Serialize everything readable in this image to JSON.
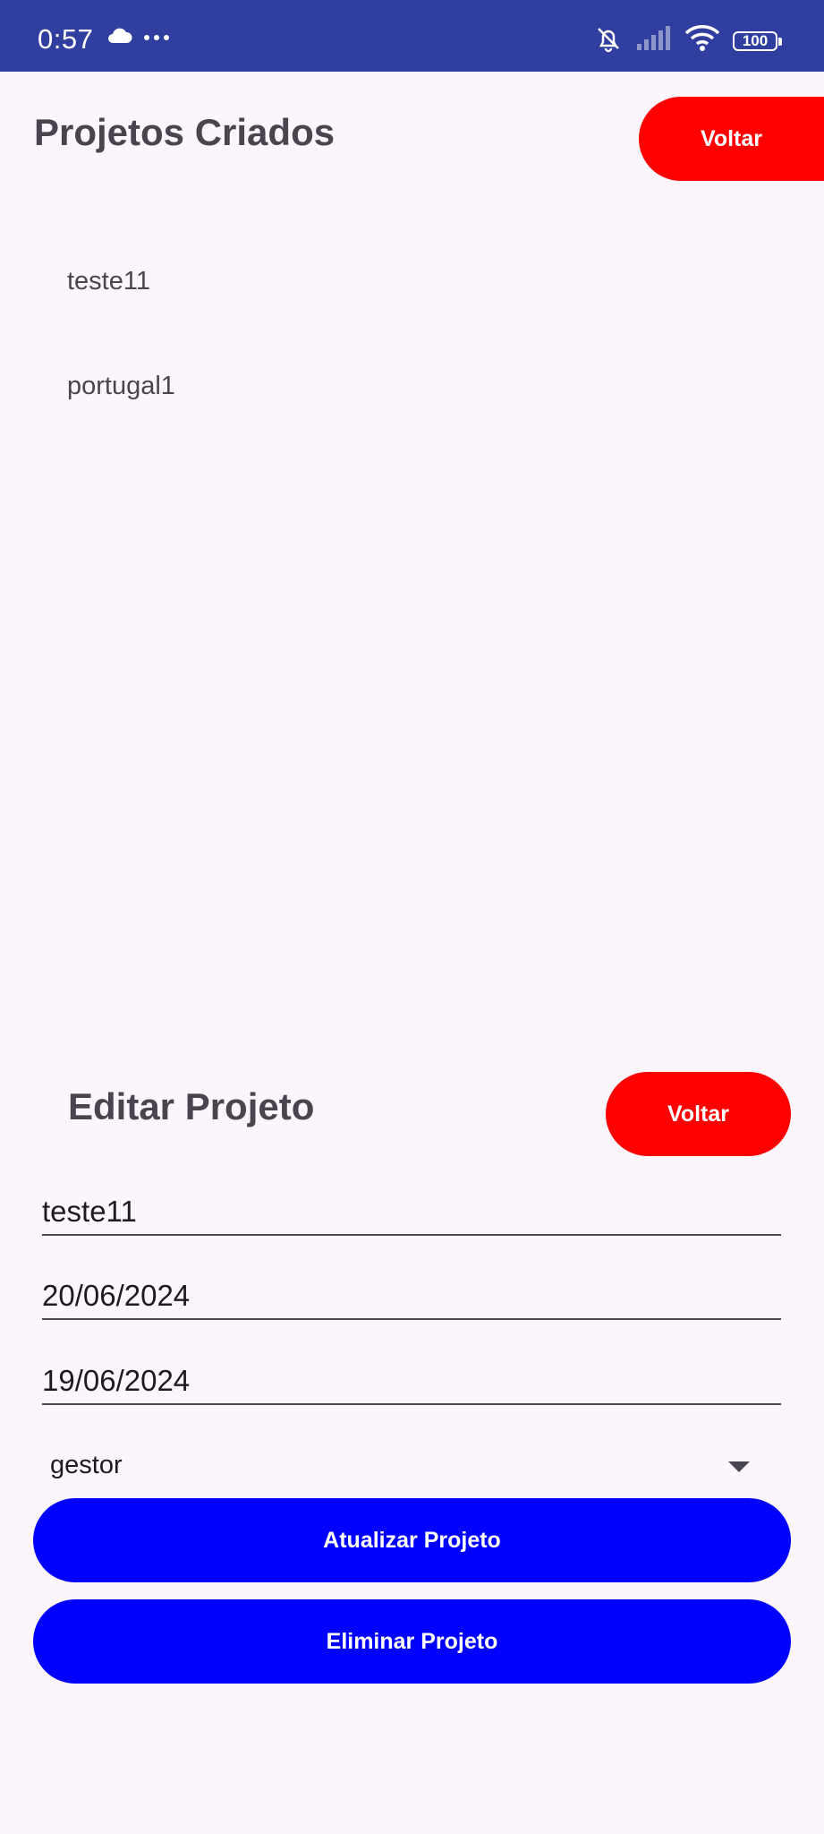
{
  "status_bar": {
    "time": "0:57",
    "battery": "100",
    "icons": [
      "cloud-icon",
      "more-dots-icon",
      "silent-bell-icon",
      "signal-icon",
      "wifi-icon",
      "battery-icon"
    ]
  },
  "projects_section": {
    "title": "Projetos Criados",
    "back_label": "Voltar",
    "items": [
      "teste11",
      "portugal1"
    ]
  },
  "edit_section": {
    "title": "Editar Projeto",
    "back_label": "Voltar",
    "fields": {
      "name": "teste11",
      "date1": "20/06/2024",
      "date2": "19/06/2024",
      "role_selected": "gestor"
    },
    "update_label": "Atualizar Projeto",
    "delete_label": "Eliminar Projeto"
  },
  "colors": {
    "status_bar": "#303f9f",
    "background": "#fcf6fc",
    "back_button": "#ff0000",
    "action_button": "#0000ff",
    "title_text": "#49454f"
  }
}
